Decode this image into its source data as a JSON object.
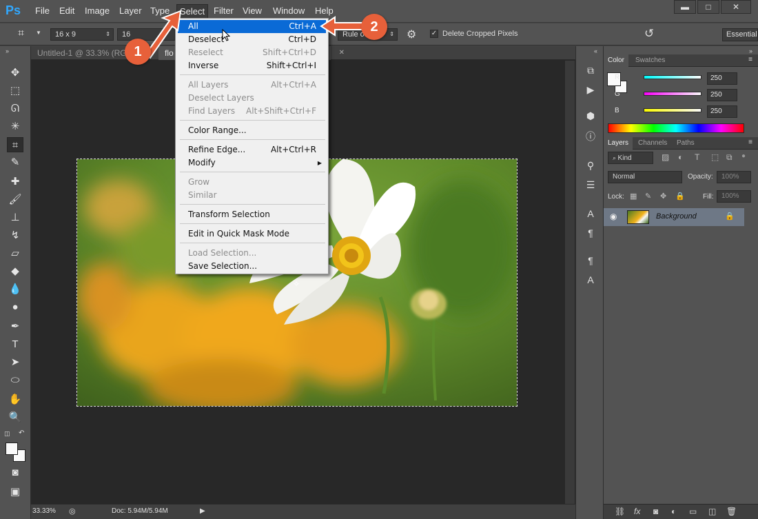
{
  "menubar": {
    "logo": "Ps",
    "items": [
      "File",
      "Edit",
      "Image",
      "Layer",
      "Type",
      "Select",
      "Filter",
      "View",
      "Window",
      "Help"
    ],
    "active": "Select"
  },
  "window_buttons": {
    "minimize": "▬",
    "maximize": "□",
    "close": "✕"
  },
  "options": {
    "ratio": "16 x 9",
    "width_value": "16",
    "overlay": "Rule of",
    "delete_cropped_label": "Delete Cropped Pixels",
    "workspace": "Essential"
  },
  "doc": {
    "tabs": [
      {
        "label": "Untitled-1 @ 33.3% (RGB"
      },
      {
        "label": "flo"
      }
    ],
    "zoom": "33.33%",
    "doc_size": "Doc: 5.94M/5.94M"
  },
  "select_menu": {
    "items": [
      {
        "label": "All",
        "shortcut": "Ctrl+A",
        "state": "highlight"
      },
      {
        "label": "Deselect",
        "shortcut": "Ctrl+D",
        "state": "enabled"
      },
      {
        "label": "Reselect",
        "shortcut": "Shift+Ctrl+D",
        "state": "disabled"
      },
      {
        "label": "Inverse",
        "shortcut": "Shift+Ctrl+I",
        "state": "enabled"
      },
      {
        "label": "All Layers",
        "shortcut": "Alt+Ctrl+A",
        "state": "disabled"
      },
      {
        "label": "Deselect Layers",
        "shortcut": "",
        "state": "disabled"
      },
      {
        "label": "Find Layers",
        "shortcut": "Alt+Shift+Ctrl+F",
        "state": "disabled"
      },
      {
        "label": "Color Range...",
        "shortcut": "",
        "state": "enabled"
      },
      {
        "label": "Refine Edge...",
        "shortcut": "Alt+Ctrl+R",
        "state": "enabled"
      },
      {
        "label": "Modify",
        "shortcut": "",
        "state": "submenu"
      },
      {
        "label": "Grow",
        "shortcut": "",
        "state": "disabled"
      },
      {
        "label": "Similar",
        "shortcut": "",
        "state": "disabled"
      },
      {
        "label": "Transform Selection",
        "shortcut": "",
        "state": "enabled"
      },
      {
        "label": "Edit in Quick Mask Mode",
        "shortcut": "",
        "state": "enabled"
      },
      {
        "label": "Load Selection...",
        "shortcut": "",
        "state": "disabled"
      },
      {
        "label": "Save Selection...",
        "shortcut": "",
        "state": "enabled"
      }
    ]
  },
  "color_panel": {
    "tabs": [
      "Color",
      "Swatches"
    ],
    "channels": [
      {
        "label": "R",
        "value": "250",
        "gradient_from": "#00fafa",
        "gradient_to": "#fafafa"
      },
      {
        "label": "G",
        "value": "250",
        "gradient_from": "#fa00fa",
        "gradient_to": "#fafafa"
      },
      {
        "label": "B",
        "value": "250",
        "gradient_from": "#fafa00",
        "gradient_to": "#fafafa"
      }
    ]
  },
  "layers_panel": {
    "tabs": [
      "Layers",
      "Channels",
      "Paths"
    ],
    "filter_kind": "Kind",
    "blend_mode": "Normal",
    "opacity_label": "Opacity:",
    "opacity_value": "100%",
    "lock_label": "Lock:",
    "fill_label": "Fill:",
    "fill_value": "100%",
    "layers": [
      {
        "name": "Background"
      }
    ]
  },
  "callouts": [
    "1",
    "2"
  ],
  "colors": {
    "menu_highlight": "#0a6ad6",
    "callout": "#e7603a",
    "app_bg": "#535353"
  }
}
